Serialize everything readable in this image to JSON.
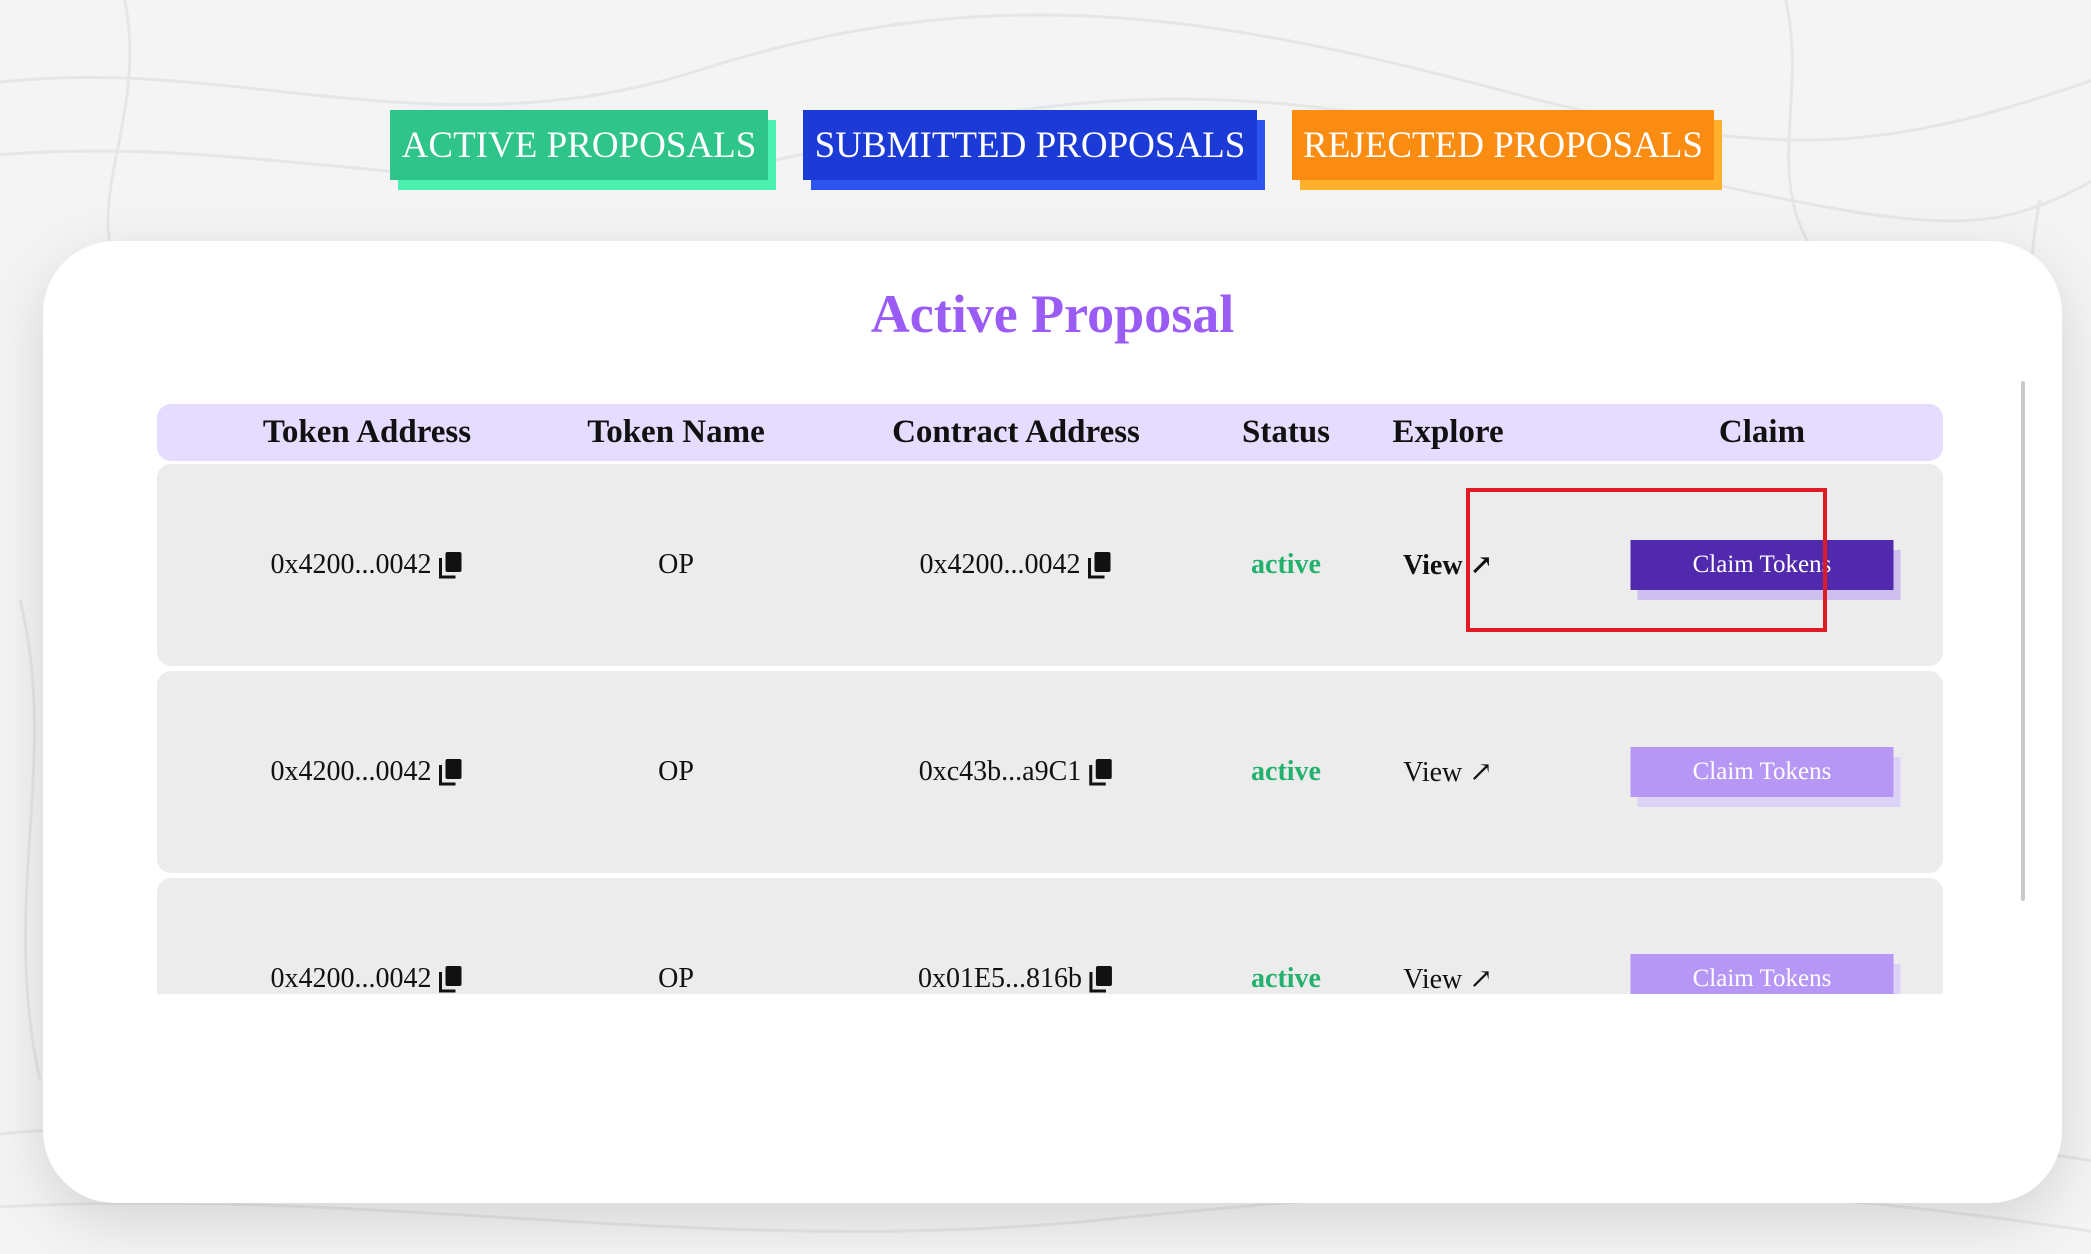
{
  "tabs": [
    {
      "label": "ACTIVE PROPOSALS",
      "color": "#2ec48a"
    },
    {
      "label": "SUBMITTED PROPOSALS",
      "color": "#1c3bd6"
    },
    {
      "label": "REJECTED PROPOSALS",
      "color": "#fb8c12"
    }
  ],
  "card": {
    "title": "Active Proposal",
    "title_color": "#9b5cf6"
  },
  "table": {
    "headers": [
      "Token Address",
      "Token Name",
      "Contract Address",
      "Status",
      "Explore",
      "Claim"
    ],
    "rows": [
      {
        "token_address": "0x4200...0042",
        "token_name": "OP",
        "contract_address": "0x4200...0042",
        "status": "active",
        "explore": "View ↗",
        "claim": "Claim Tokens",
        "enabled": true
      },
      {
        "token_address": "0x4200...0042",
        "token_name": "OP",
        "contract_address": "0xc43b...a9C1",
        "status": "active",
        "explore": "View ↗",
        "claim": "Claim Tokens",
        "enabled": false
      },
      {
        "token_address": "0x4200...0042",
        "token_name": "OP",
        "contract_address": "0x01E5...816b",
        "status": "active",
        "explore": "View ↗",
        "claim": "Claim Tokens",
        "enabled": false
      }
    ]
  },
  "colors": {
    "status_active": "#23b26d",
    "claim_enabled": "#5129ad",
    "claim_disabled": "#b697f6",
    "header_bg": "#e5dcff",
    "highlight": "#e01b24"
  },
  "icons": {
    "copy": "copy-icon",
    "external_link": "arrow-up-right-icon"
  }
}
